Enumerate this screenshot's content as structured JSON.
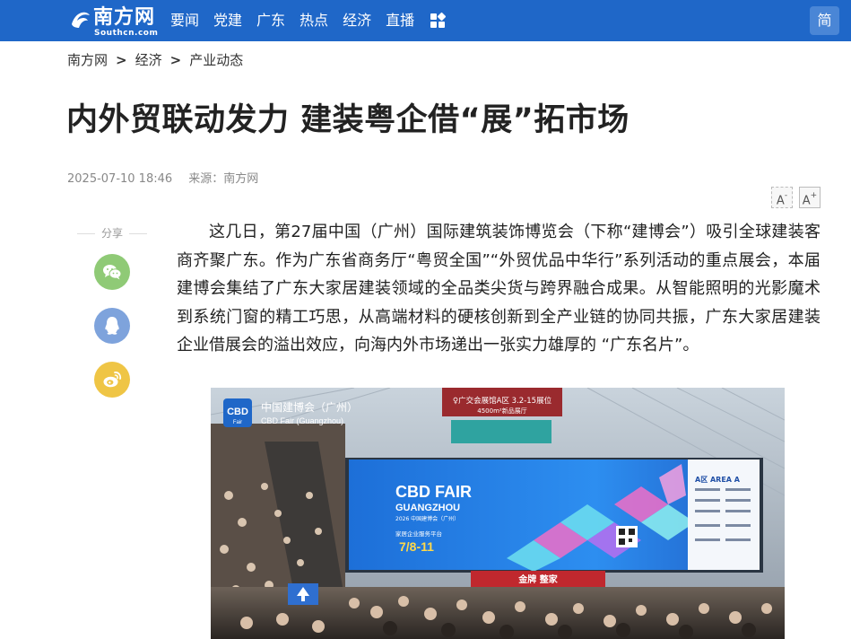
{
  "header": {
    "logo": {
      "name_cn": "南方网",
      "domain": "Southcn.com"
    },
    "nav": [
      "要闻",
      "党建",
      "广东",
      "热点",
      "经济",
      "直播"
    ],
    "lang_toggle": "简",
    "brand_color": "#1f67c8"
  },
  "breadcrumb": [
    "南方网",
    "经济",
    "产业动态"
  ],
  "breadcrumb_separator": ">",
  "article": {
    "title": "内外贸联动发力 建装粤企借“展”拓市场",
    "date": "2025-07-10 18:46",
    "source": "来源：南方网",
    "font_decrease": "A",
    "font_increase": "A",
    "paragraph": "这几日，第27届中国（广州）国际建筑装饰博览会（下称“建博会”）吸引全球建装客商齐聚广东。作为广东省商务厅“粤贸全国”“外贸优品中华行”系列活动的重点展会，本届建博会集结了广东大家居建装领域的全品类尖货与跨界融合成果。从智能照明的光影魔术到系统门窗的精工巧思，从高端材料的硬核创新到全产业链的协同共振，广东大家居建装企业借展会的溢出效应，向海内外市场递出一张实力雄厚的 “广东名片”。"
  },
  "share": {
    "label": "分享",
    "icons": [
      "wechat-icon",
      "qq-icon",
      "weibo-icon"
    ],
    "colors": {
      "wechat": "#8fca76",
      "qq": "#7ea3dc",
      "weibo": "#efc545"
    }
  },
  "photo": {
    "watermark_cn": "中国建博会（广州）",
    "watermark_en": "CBD Fair (Guangzhou)",
    "badge": "CBD",
    "badge_sub": "Fair",
    "top_sign": "♀广交会展馆A区 3.2-15展位",
    "top_sign_sub": "4500m²新品展厅",
    "screen_title": "CBD FAIR",
    "screen_subtitle": "GUANGZHOU",
    "screen_caption": "2026 中国建博会（广州）",
    "screen_platform": "家居企业服务平台",
    "screen_dates": "7/8-11",
    "area_label": "A区 AREA A",
    "bottom_sign": "金牌 整家"
  }
}
